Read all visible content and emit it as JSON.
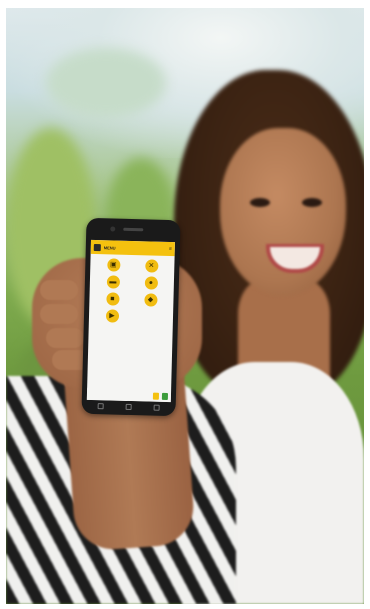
{
  "scene": {
    "subject": "woman holding smartphone",
    "colors": {
      "accent": "#f4c10f",
      "confirm": "#3c9d3c"
    }
  },
  "phone_app": {
    "header": {
      "title": "MENU",
      "logo_icon": "user-icon",
      "menu_icon": "menu-icon"
    },
    "subtitle": "",
    "tiles": [
      {
        "label": "",
        "icon": "box-icon"
      },
      {
        "label": "",
        "icon": "tools-icon"
      },
      {
        "label": "",
        "icon": "clipboard-icon"
      },
      {
        "label": "",
        "icon": "people-icon"
      },
      {
        "label": "",
        "icon": "bag-icon"
      },
      {
        "label": "",
        "icon": "chat-icon"
      },
      {
        "label": "",
        "icon": "truck-icon"
      }
    ],
    "footer": {
      "secondary_button": "",
      "primary_button": ""
    }
  }
}
